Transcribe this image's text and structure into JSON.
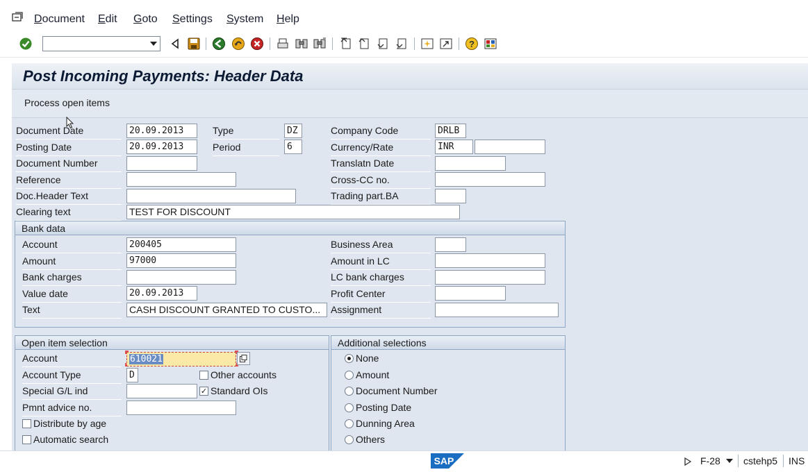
{
  "menu": [
    "Document",
    "Edit",
    "Goto",
    "Settings",
    "System",
    "Help"
  ],
  "command_field": {
    "value": ""
  },
  "header": {
    "title": "Post Incoming Payments: Header Data",
    "process_button": "Process open items"
  },
  "labels": {
    "document_date": "Document Date",
    "posting_date": "Posting Date",
    "document_number": "Document Number",
    "reference": "Reference",
    "doc_header_text": "Doc.Header Text",
    "clearing_text": "Clearing text",
    "type": "Type",
    "period": "Period",
    "company_code": "Company Code",
    "currency_rate": "Currency/Rate",
    "translatn_date": "Translatn Date",
    "cross_cc": "Cross-CC no.",
    "trading_part": "Trading part.BA"
  },
  "values": {
    "document_date": "20.09.2013",
    "posting_date": "20.09.2013",
    "document_number": "",
    "reference": "",
    "doc_header_text": "",
    "clearing_text": "TEST FOR DISCOUNT",
    "type": "DZ",
    "period": "6",
    "company_code": "DRLB",
    "currency": "INR",
    "rate": "",
    "translatn_date": "",
    "cross_cc": "",
    "trading_part": ""
  },
  "bank_data": {
    "title": "Bank data",
    "labels": {
      "account": "Account",
      "amount": "Amount",
      "bank_charges": "Bank charges",
      "value_date": "Value date",
      "text": "Text",
      "business_area": "Business Area",
      "amount_lc": "Amount in LC",
      "lc_bank_charges": "LC bank charges",
      "profit_center": "Profit Center",
      "assignment": "Assignment"
    },
    "values": {
      "account": "200405",
      "amount": "97000",
      "bank_charges": "",
      "value_date": "20.09.2013",
      "text": "CASH DISCOUNT GRANTED TO CUSTO...",
      "business_area": "",
      "amount_lc": "",
      "lc_bank_charges": "",
      "profit_center": "",
      "assignment": ""
    }
  },
  "open_items": {
    "title": "Open item selection",
    "labels": {
      "account": "Account",
      "account_type": "Account Type",
      "special_gl": "Special G/L ind",
      "pmnt_advice": "Pmnt advice no.",
      "other_accounts": "Other accounts",
      "standard_ois": "Standard OIs",
      "distribute_by_age": "Distribute by age",
      "automatic_search": "Automatic search"
    },
    "values": {
      "account": "610021",
      "account_type": "D",
      "special_gl": "",
      "pmnt_advice": ""
    },
    "checks": {
      "other_accounts": false,
      "standard_ois": true,
      "distribute_by_age": false,
      "automatic_search": false
    }
  },
  "additional": {
    "title": "Additional selections",
    "options": [
      "None",
      "Amount",
      "Document Number",
      "Posting Date",
      "Dunning Area",
      "Others"
    ],
    "selected": "None"
  },
  "status": {
    "logo": "SAP",
    "tcode": "F-28",
    "server": "cstehp5",
    "mode": "INS"
  },
  "colors": {
    "screen_bg": "#dfe6ef",
    "group_border": "#8fa6c2",
    "focus_field": "#fbe9a8"
  }
}
